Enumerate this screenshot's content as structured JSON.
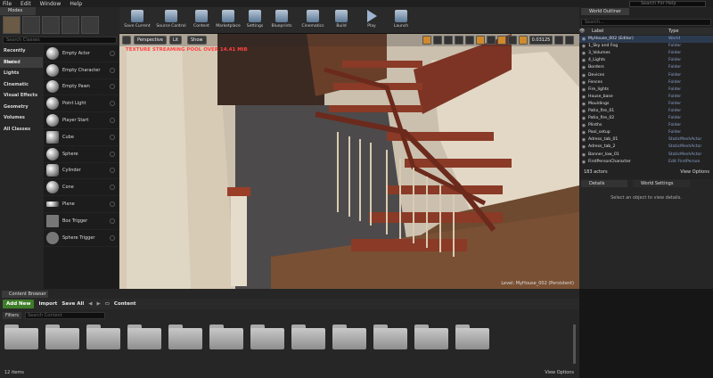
{
  "menubar": {
    "items": [
      "File",
      "Edit",
      "Window",
      "Help"
    ],
    "search_placeholder": "Search For Help"
  },
  "modes": {
    "tab_label": "Modes",
    "search_placeholder": "Search Classes",
    "categories": [
      {
        "label": "Recently Placed"
      },
      {
        "label": "Basic",
        "selected": true
      },
      {
        "label": "Lights"
      },
      {
        "label": "Cinematic"
      },
      {
        "label": "Visual Effects"
      },
      {
        "label": "Geometry"
      },
      {
        "label": "Volumes"
      },
      {
        "label": "All Classes"
      }
    ],
    "items": [
      "Empty Actor",
      "Empty Character",
      "Empty Pawn",
      "Point Light",
      "Player Start",
      "Cube",
      "Sphere",
      "Cylinder",
      "Cone",
      "Plane",
      "Box Trigger",
      "Sphere Trigger"
    ]
  },
  "toolbar": {
    "buttons": [
      "Save Current",
      "Source Control",
      "Content",
      "Marketplace",
      "Settings",
      "Blueprints",
      "Cinematics",
      "Build",
      "Play",
      "Launch"
    ]
  },
  "viewport": {
    "perspective": "Perspective",
    "lit": "Lit",
    "show": "Show",
    "snap_value": "0.03125",
    "warning": "TEXTURE STREAMING POOL OVER 14.41 MiB",
    "level_label": "Level: MyHouse_002 (Persistent)"
  },
  "outliner": {
    "tab_label": "World Outliner",
    "search_placeholder": "Search...",
    "col_label": "Label",
    "col_type": "Type",
    "rows": [
      {
        "label": "MyHouse_002 (Editor)",
        "type": "World"
      },
      {
        "label": "1_Sky and Fog",
        "type": "Folder"
      },
      {
        "label": "3_Volumes",
        "type": "Folder"
      },
      {
        "label": "4_Lights",
        "type": "Folder"
      },
      {
        "label": "Borders",
        "type": "Folder"
      },
      {
        "label": "Devices",
        "type": "Folder"
      },
      {
        "label": "Fences",
        "type": "Folder"
      },
      {
        "label": "Fire_lights",
        "type": "Folder"
      },
      {
        "label": "House_base",
        "type": "Folder"
      },
      {
        "label": "Mouldings",
        "type": "Folder"
      },
      {
        "label": "Patio_fire_01",
        "type": "Folder"
      },
      {
        "label": "Patio_fire_02",
        "type": "Folder"
      },
      {
        "label": "Plinths",
        "type": "Folder"
      },
      {
        "label": "Pool_setup",
        "type": "Folder"
      },
      {
        "label": "Adress_tab_01",
        "type": "StaticMeshActor"
      },
      {
        "label": "Adress_tab_2",
        "type": "StaticMeshActor"
      },
      {
        "label": "Banner_low_01",
        "type": "StaticMeshActor"
      },
      {
        "label": "FirstPersonCharacter",
        "type": "Edit FirstPerson"
      }
    ],
    "footer_count": "183 actors",
    "view_options": "View Options"
  },
  "details": {
    "tab_details": "Details",
    "tab_world": "World Settings",
    "empty_msg": "Select an object to view details."
  },
  "content_browser": {
    "tab_label": "Content Browser",
    "add_new": "Add New",
    "import": "Import",
    "save_all": "Save All",
    "path": "Content",
    "filters": "Filters",
    "search_placeholder": "Search Content",
    "folder_count": 12,
    "items_count": "12 items",
    "view_options": "View Options"
  },
  "colors": {
    "accent": "#d08a2a",
    "add_new": "#3e7c29"
  }
}
